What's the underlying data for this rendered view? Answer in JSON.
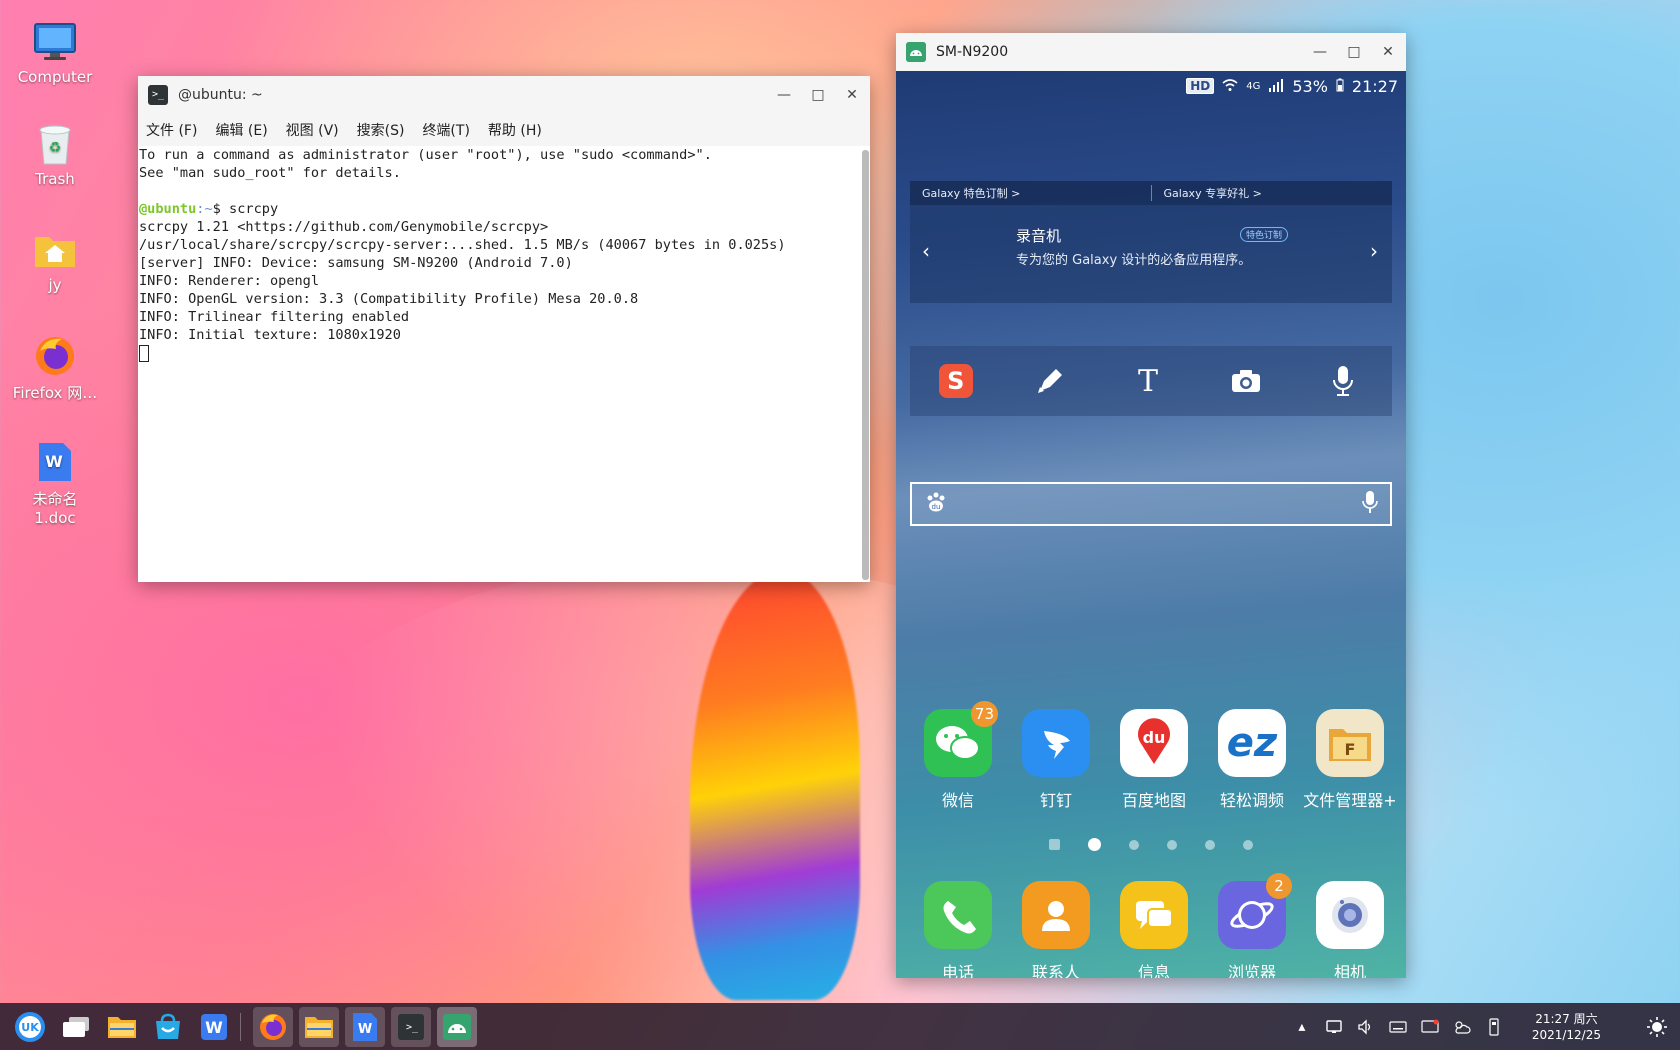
{
  "desktop": {
    "icons": [
      {
        "label": "Computer",
        "icon": "computer-icon"
      },
      {
        "label": "Trash",
        "icon": "trash-icon"
      },
      {
        "label": "jy",
        "icon": "home-folder-icon"
      },
      {
        "label": "Firefox 网…",
        "icon": "firefox-icon"
      },
      {
        "label": "未命名 1.doc",
        "icon": "document-icon"
      }
    ]
  },
  "terminal": {
    "title": "​@ubuntu: ~",
    "menu": [
      "文件 (F)",
      "编辑 (E)",
      "视图 (V)",
      "搜索(S)",
      "终端(T)",
      "帮助 (H)"
    ],
    "lines": [
      "To run a command as administrator (user \"root\"), use \"sudo <command>\".",
      "See \"man sudo_root\" for details.",
      ""
    ],
    "prompt_user": "@ubuntu",
    "prompt_path": ":~",
    "prompt_cmd": "$ scrcpy",
    "output": [
      "scrcpy 1.21 <https://github.com/Genymobile/scrcpy>",
      "/usr/local/share/scrcpy/scrcpy-server:...shed. 1.5 MB/s (40067 bytes in 0.025s)",
      "[server] INFO: Device: samsung SM-N9200 (Android 7.0)",
      "INFO: Renderer: opengl",
      "INFO: OpenGL version: 3.3 (Compatibility Profile) Mesa 20.0.8",
      "INFO: Trilinear filtering enabled",
      "INFO: Initial texture: 1080x1920"
    ]
  },
  "phone": {
    "title": "SM-N9200",
    "status": {
      "hd": "HD",
      "network": "4G",
      "battery": "53%",
      "time": "21:27"
    },
    "galaxy_tabs": [
      "Galaxy 特色订制  >",
      "Galaxy 专享好礼  >"
    ],
    "galaxy_card": {
      "title": "录音机",
      "badge": "特色订制",
      "desc": "专为您的 Galaxy 设计的必备应用程序。"
    },
    "apps_row1": [
      {
        "label": "微信",
        "badge": "73",
        "color": "#2fc153"
      },
      {
        "label": "钉钉",
        "badge": "",
        "color": "#2a8ff0"
      },
      {
        "label": "百度地图",
        "badge": "",
        "color": "#ffffff"
      },
      {
        "label": "轻松调频",
        "badge": "",
        "color": "#ffffff"
      },
      {
        "label": "文件管理器+",
        "badge": "",
        "color": "#f2e6c8"
      }
    ],
    "apps_row2": [
      {
        "label": "电话",
        "badge": "",
        "color": "#4cc85a"
      },
      {
        "label": "联系人",
        "badge": "",
        "color": "#f39a20"
      },
      {
        "label": "信息",
        "badge": "",
        "color": "#f4c21a"
      },
      {
        "label": "浏览器",
        "badge": "2",
        "color": "#6a66e0"
      },
      {
        "label": "相机",
        "badge": "",
        "color": "#ffffff"
      }
    ]
  },
  "taskbar": {
    "clock_time": "21:27 周六",
    "clock_date": "2021/12/25"
  }
}
